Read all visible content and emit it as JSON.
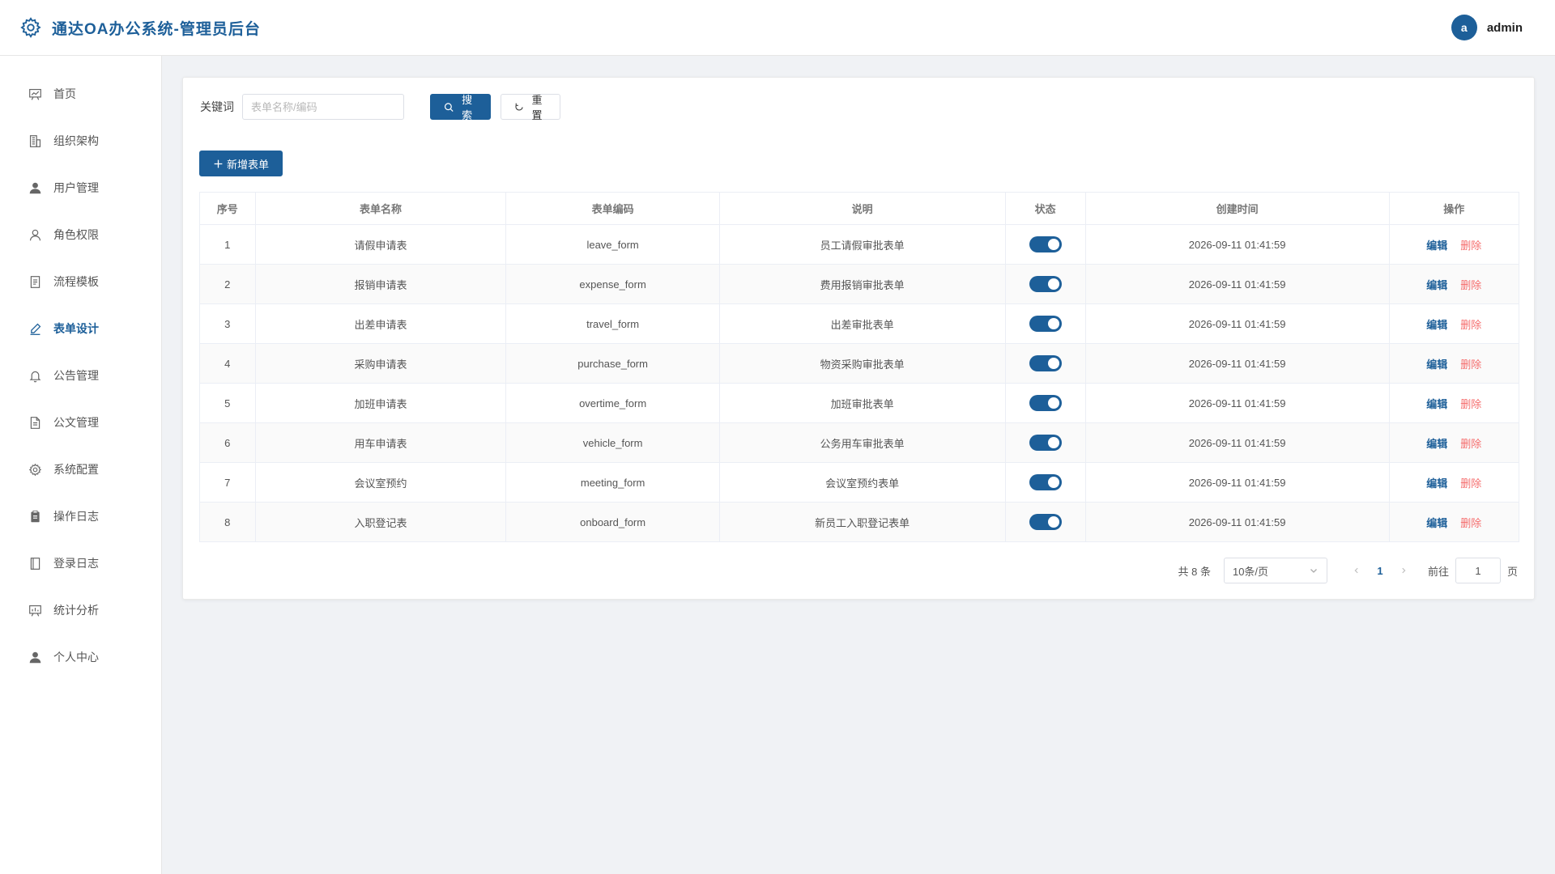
{
  "header": {
    "title": "通达OA办公系统-管理员后台",
    "avatar_letter": "a",
    "username": "admin"
  },
  "sidebar": {
    "items": [
      {
        "label": "首页",
        "icon": "dashboard-icon"
      },
      {
        "label": "组织架构",
        "icon": "building-icon"
      },
      {
        "label": "用户管理",
        "icon": "user-filled-icon"
      },
      {
        "label": "角色权限",
        "icon": "user-outline-icon"
      },
      {
        "label": "流程模板",
        "icon": "document-icon"
      },
      {
        "label": "表单设计",
        "icon": "edit-pen-icon",
        "active": true
      },
      {
        "label": "公告管理",
        "icon": "bell-icon"
      },
      {
        "label": "公文管理",
        "icon": "file-text-icon"
      },
      {
        "label": "系统配置",
        "icon": "gear-icon"
      },
      {
        "label": "操作日志",
        "icon": "clipboard-icon"
      },
      {
        "label": "登录日志",
        "icon": "notebook-icon"
      },
      {
        "label": "统计分析",
        "icon": "chart-board-icon"
      },
      {
        "label": "个人中心",
        "icon": "user-filled-icon"
      }
    ]
  },
  "search": {
    "label": "关键词",
    "placeholder": "表单名称/编码",
    "value": "",
    "search_label": "搜索",
    "reset_label": "重置"
  },
  "toolbar": {
    "add_label": "新增表单"
  },
  "table": {
    "columns": [
      "序号",
      "表单名称",
      "表单编码",
      "说明",
      "状态",
      "创建时间",
      "操作"
    ],
    "edit_label": "编辑",
    "delete_label": "删除",
    "rows": [
      {
        "index": "1",
        "name": "请假申请表",
        "code": "leave_form",
        "desc": "员工请假审批表单",
        "enabled": true,
        "created": "2026-09-11 01:41:59"
      },
      {
        "index": "2",
        "name": "报销申请表",
        "code": "expense_form",
        "desc": "费用报销审批表单",
        "enabled": true,
        "created": "2026-09-11 01:41:59"
      },
      {
        "index": "3",
        "name": "出差申请表",
        "code": "travel_form",
        "desc": "出差审批表单",
        "enabled": true,
        "created": "2026-09-11 01:41:59"
      },
      {
        "index": "4",
        "name": "采购申请表",
        "code": "purchase_form",
        "desc": "物资采购审批表单",
        "enabled": true,
        "created": "2026-09-11 01:41:59"
      },
      {
        "index": "5",
        "name": "加班申请表",
        "code": "overtime_form",
        "desc": "加班审批表单",
        "enabled": true,
        "created": "2026-09-11 01:41:59"
      },
      {
        "index": "6",
        "name": "用车申请表",
        "code": "vehicle_form",
        "desc": "公务用车审批表单",
        "enabled": true,
        "created": "2026-09-11 01:41:59"
      },
      {
        "index": "7",
        "name": "会议室预约",
        "code": "meeting_form",
        "desc": "会议室预约表单",
        "enabled": true,
        "created": "2026-09-11 01:41:59"
      },
      {
        "index": "8",
        "name": "入职登记表",
        "code": "onboard_form",
        "desc": "新员工入职登记表单",
        "enabled": true,
        "created": "2026-09-11 01:41:59"
      }
    ]
  },
  "pagination": {
    "total_text": "共 8 条",
    "page_size": "10条/页",
    "current_page": "1",
    "goto_label": "前往",
    "goto_value": "1",
    "page_unit": "页"
  },
  "colors": {
    "primary": "#1d5f99",
    "danger": "#f56c6c",
    "background": "#f0f2f5"
  }
}
